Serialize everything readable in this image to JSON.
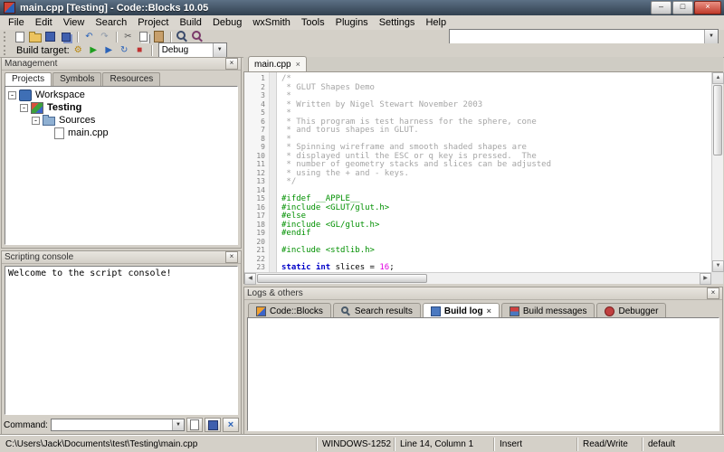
{
  "window": {
    "title": "main.cpp [Testing] - Code::Blocks 10.05"
  },
  "icons": {
    "close": "×",
    "dropdown": "▼",
    "minimize": "–",
    "maximize": "□",
    "up": "▲",
    "down": "▼",
    "left": "◀",
    "right": "▶",
    "expander": "-"
  },
  "menu": {
    "items": [
      "File",
      "Edit",
      "View",
      "Search",
      "Project",
      "Build",
      "Debug",
      "wxSmith",
      "Tools",
      "Plugins",
      "Settings",
      "Help"
    ]
  },
  "toolbar1": {
    "icons": [
      {
        "name": "new-file-button",
        "icon": "new-file-icon",
        "style": "page"
      },
      {
        "name": "open-file-button",
        "icon": "open-folder-icon",
        "style": "folder"
      },
      {
        "name": "save-button",
        "icon": "save-icon",
        "style": "floppy"
      },
      {
        "name": "save-all-button",
        "icon": "save-all-icon",
        "style": "floppy2"
      },
      {
        "sep": true
      },
      {
        "name": "undo-button",
        "icon": "undo-icon",
        "glyph": "↶",
        "color": "#2a62b8"
      },
      {
        "name": "redo-button",
        "icon": "redo-icon",
        "glyph": "↷",
        "color": "#8c98a8"
      },
      {
        "sep": true
      },
      {
        "name": "cut-button",
        "icon": "cut-icon",
        "glyph": "✂",
        "color": "#555555"
      },
      {
        "name": "copy-button",
        "icon": "copy-icon",
        "style": "copy"
      },
      {
        "name": "paste-button",
        "icon": "paste-icon",
        "style": "paste"
      },
      {
        "sep": true
      },
      {
        "name": "find-button",
        "icon": "find-icon",
        "style": "find"
      },
      {
        "name": "replace-button",
        "icon": "replace-icon",
        "style": "replace"
      }
    ]
  },
  "toolbar2": {
    "icons": [
      {
        "name": "compile-button",
        "icon": "gear-icon",
        "glyph": "⚙",
        "color": "#b8860b"
      },
      {
        "name": "run-button",
        "icon": "play-icon",
        "glyph": "▶",
        "color": "#1f9e1f"
      },
      {
        "name": "build-and-run-button",
        "icon": "gear-play-icon",
        "glyph": "▶",
        "color": "#2a62b8"
      },
      {
        "name": "rebuild-button",
        "icon": "rebuild-icon",
        "glyph": "↻",
        "color": "#2a62b8"
      },
      {
        "name": "abort-button",
        "icon": "abort-icon",
        "glyph": "■",
        "color": "#c03030"
      },
      {
        "sep": true
      }
    ],
    "build_target_label": "Build target:",
    "build_target_value": "Debug"
  },
  "management": {
    "title": "Management",
    "tabs": [
      "Projects",
      "Symbols",
      "Resources"
    ],
    "tree": [
      {
        "name": "tree-item-workspace",
        "label": "Workspace",
        "level": 0,
        "icon": "workspace",
        "expander": true,
        "bold": false
      },
      {
        "name": "tree-item-testing",
        "label": "Testing",
        "level": 1,
        "icon": "project",
        "expander": true,
        "bold": true
      },
      {
        "name": "tree-item-sources",
        "label": "Sources",
        "level": 2,
        "icon": "folder",
        "expander": true,
        "bold": false
      },
      {
        "name": "tree-item-main-cpp",
        "label": "main.cpp",
        "level": 3,
        "icon": "file",
        "expander": false,
        "bold": false
      }
    ]
  },
  "scripting": {
    "title": "Scripting console",
    "welcome": "Welcome to the script console!",
    "command_label": "Command:"
  },
  "editor": {
    "tab_label": "main.cpp",
    "lines": [
      [
        {
          "c": "comment",
          "t": "/*"
        }
      ],
      [
        {
          "c": "comment",
          "t": " * GLUT Shapes Demo"
        }
      ],
      [
        {
          "c": "comment",
          "t": " *"
        }
      ],
      [
        {
          "c": "comment",
          "t": " * Written by Nigel Stewart November 2003"
        }
      ],
      [
        {
          "c": "comment",
          "t": " *"
        }
      ],
      [
        {
          "c": "comment",
          "t": " * This program is test harness for the sphere, cone"
        }
      ],
      [
        {
          "c": "comment",
          "t": " * and torus shapes in GLUT."
        }
      ],
      [
        {
          "c": "comment",
          "t": " *"
        }
      ],
      [
        {
          "c": "comment",
          "t": " * Spinning wireframe and smooth shaded shapes are"
        }
      ],
      [
        {
          "c": "comment",
          "t": " * displayed until the ESC or q key is pressed.  The"
        }
      ],
      [
        {
          "c": "comment",
          "t": " * number of geometry stacks and slices can be adjusted"
        }
      ],
      [
        {
          "c": "comment",
          "t": " * using the + and - keys."
        }
      ],
      [
        {
          "c": "comment",
          "t": " */"
        }
      ],
      [],
      [
        {
          "c": "preproc",
          "t": "#ifdef __APPLE__"
        }
      ],
      [
        {
          "c": "preproc",
          "t": "#include <GLUT/glut.h>"
        }
      ],
      [
        {
          "c": "preproc",
          "t": "#else"
        }
      ],
      [
        {
          "c": "preproc",
          "t": "#include <GL/glut.h>"
        }
      ],
      [
        {
          "c": "preproc",
          "t": "#endif"
        }
      ],
      [],
      [
        {
          "c": "preproc",
          "t": "#include <stdlib.h>"
        }
      ],
      [],
      [
        {
          "c": "keyword",
          "t": "static"
        },
        {
          "c": "plain",
          "t": " "
        },
        {
          "c": "keyword",
          "t": "int"
        },
        {
          "c": "plain",
          "t": " slices = "
        },
        {
          "c": "number",
          "t": "16"
        },
        {
          "c": "plain",
          "t": ";"
        }
      ]
    ]
  },
  "logs": {
    "title": "Logs & others",
    "tabs": [
      {
        "label": "Code::Blocks",
        "icon": "codeblocks-icon",
        "active": false,
        "closable": false
      },
      {
        "label": "Search results",
        "icon": "search-icon",
        "active": false,
        "closable": false
      },
      {
        "label": "Build log",
        "icon": "build-log-icon",
        "active": true,
        "closable": true
      },
      {
        "label": "Build messages",
        "icon": "build-messages-icon",
        "active": false,
        "closable": false
      },
      {
        "label": "Debugger",
        "icon": "debugger-icon",
        "active": false,
        "closable": false
      }
    ]
  },
  "statusbar": {
    "path": "C:\\Users\\Jack\\Documents\\test\\Testing\\main.cpp",
    "encoding": "WINDOWS-1252",
    "position": "Line 14, Column 1",
    "mode": "Insert",
    "readwrite": "Read/Write",
    "profile": "default"
  }
}
